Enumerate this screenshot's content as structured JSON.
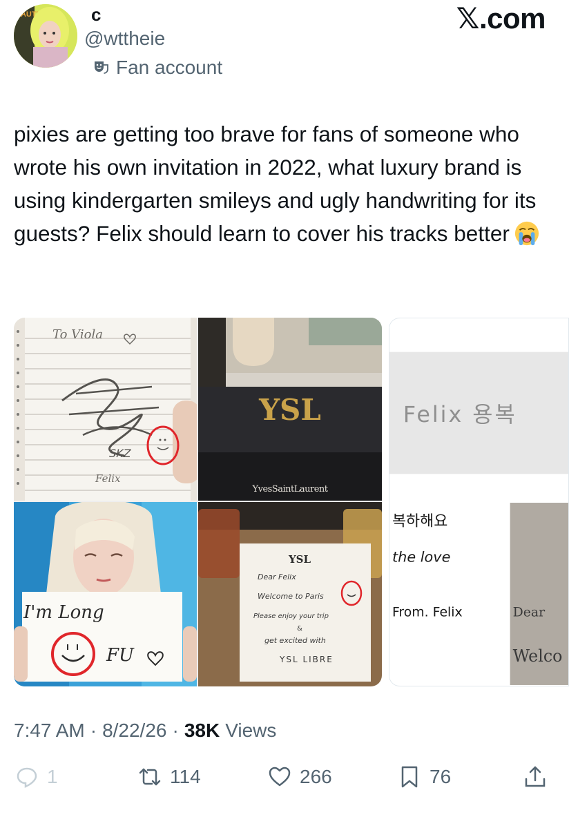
{
  "author": {
    "display_name": "c",
    "handle": "@wttheie",
    "badge_label": "Fan account",
    "avatar_sign_text": "CAUTI"
  },
  "brand": {
    "label": ".com",
    "icon": "x-logo"
  },
  "tweet": {
    "text": "pixies are getting too brave for fans of someone who wrote his own invitation in 2022, what luxury brand is using kindergarten smileys and ugly handwriting for its guests? Felix should learn to cover his tracks better",
    "emoji": "loudly-crying-face"
  },
  "media": {
    "tile1": {
      "header": "To Viola",
      "signature": "SKZ",
      "name": "Felix"
    },
    "tile2": {
      "brand_text": "YvesSaintLaurent",
      "card_lines": [
        "Dear Felix",
        "Welcome to Paris",
        "Please enjoy your trip",
        "&",
        "get excited with",
        "YSL LIBRE"
      ]
    },
    "tile3": {
      "sign_line1": "I'm Long",
      "sign_line2": "FU"
    },
    "peek": {
      "top_text": "Felix 용복",
      "line1": "복하해요",
      "line2": "the love",
      "line3": "From. Felix",
      "line4": "Dear",
      "line5": "Welco"
    }
  },
  "meta": {
    "time": "7:47 AM",
    "separator": "·",
    "date": "8/22/26",
    "views_count": "38K",
    "views_label": "Views"
  },
  "actions": {
    "replies": "1",
    "reposts": "114",
    "likes": "266",
    "bookmarks": "76"
  },
  "colors": {
    "text": "#0f1419",
    "secondary": "#536471",
    "red_circle": "#e0262b"
  }
}
